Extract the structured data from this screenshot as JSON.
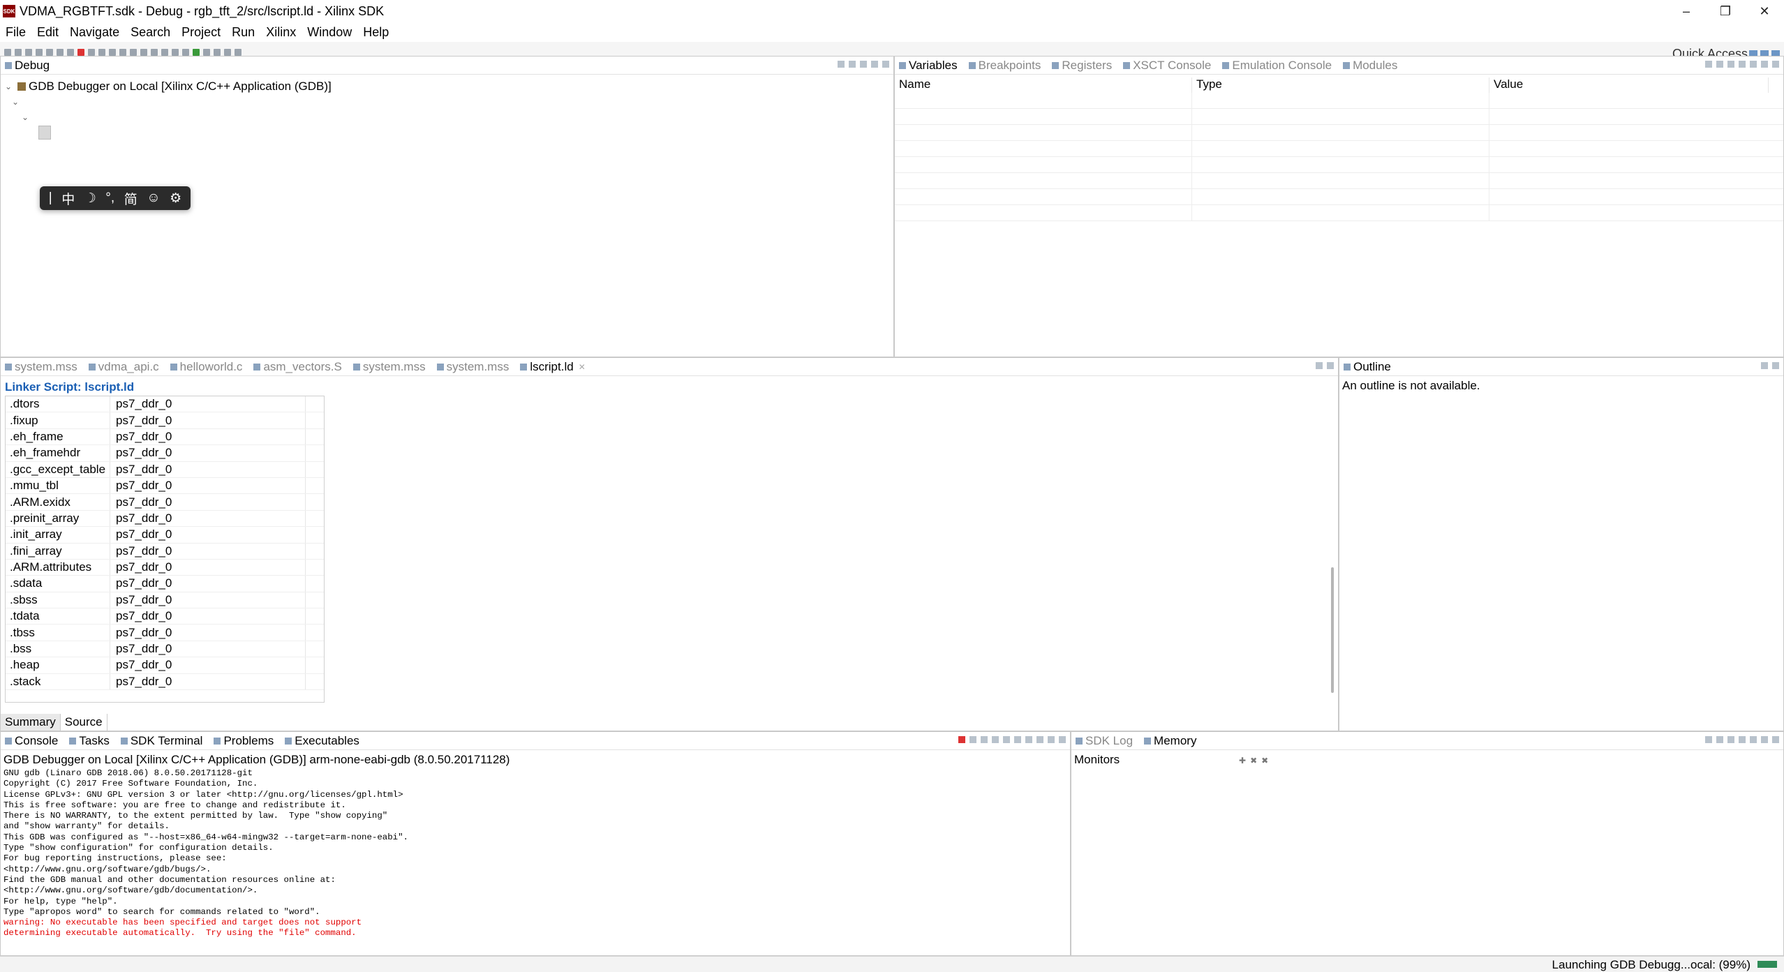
{
  "window": {
    "title": "VDMA_RGBTFT.sdk - Debug - rgb_tft_2/src/lscript.ld - Xilinx SDK",
    "app_icon": "SDK",
    "controls": [
      "–",
      "❐",
      "✕"
    ]
  },
  "menu": [
    "File",
    "Edit",
    "Navigate",
    "Search",
    "Project",
    "Run",
    "Xilinx",
    "Window",
    "Help"
  ],
  "toolbar": {
    "quick_access": "Quick Access"
  },
  "debug_view": {
    "tab": "Debug",
    "tree_root": "GDB Debugger on Local [Xilinx C/C++ Application (GDB)]"
  },
  "ime_bar": [
    "|",
    "中",
    "☽",
    "°,",
    "简",
    "☺",
    "⚙"
  ],
  "variables_view": {
    "tabs": [
      "Variables",
      "Breakpoints",
      "Registers",
      "XSCT Console",
      "Emulation Console",
      "Modules"
    ],
    "columns": [
      "Name",
      "Type",
      "Value"
    ]
  },
  "editor": {
    "tabs": [
      "system.mss",
      "vdma_api.c",
      "helloworld.c",
      "asm_vectors.S",
      "system.mss",
      "system.mss",
      "lscript.ld"
    ],
    "title": "Linker Script: lscript.ld",
    "sections": [
      {
        "name": ".dtors",
        "region": "ps7_ddr_0"
      },
      {
        "name": ".fixup",
        "region": "ps7_ddr_0"
      },
      {
        "name": ".eh_frame",
        "region": "ps7_ddr_0"
      },
      {
        "name": ".eh_framehdr",
        "region": "ps7_ddr_0"
      },
      {
        "name": ".gcc_except_table",
        "region": "ps7_ddr_0"
      },
      {
        "name": ".mmu_tbl",
        "region": "ps7_ddr_0"
      },
      {
        "name": ".ARM.exidx",
        "region": "ps7_ddr_0"
      },
      {
        "name": ".preinit_array",
        "region": "ps7_ddr_0"
      },
      {
        "name": ".init_array",
        "region": "ps7_ddr_0"
      },
      {
        "name": ".fini_array",
        "region": "ps7_ddr_0"
      },
      {
        "name": ".ARM.attributes",
        "region": "ps7_ddr_0"
      },
      {
        "name": ".sdata",
        "region": "ps7_ddr_0"
      },
      {
        "name": ".sbss",
        "region": "ps7_ddr_0"
      },
      {
        "name": ".tdata",
        "region": "ps7_ddr_0"
      },
      {
        "name": ".tbss",
        "region": "ps7_ddr_0"
      },
      {
        "name": ".bss",
        "region": "ps7_ddr_0"
      },
      {
        "name": ".heap",
        "region": "ps7_ddr_0"
      },
      {
        "name": ".stack",
        "region": "ps7_ddr_0"
      }
    ],
    "bottom_tabs": [
      "Summary",
      "Source"
    ]
  },
  "outline_view": {
    "tab": "Outline",
    "message": "An outline is not available."
  },
  "console_view": {
    "tabs": [
      "Console",
      "Tasks",
      "SDK Terminal",
      "Problems",
      "Executables"
    ],
    "description": "GDB Debugger on Local [Xilinx C/C++ Application (GDB)] arm-none-eabi-gdb (8.0.50.20171128)",
    "lines": [
      "GNU gdb (Linaro GDB 2018.06) 8.0.50.20171128-git",
      "Copyright (C) 2017 Free Software Foundation, Inc.",
      "License GPLv3+: GNU GPL version 3 or later <http://gnu.org/licenses/gpl.html>",
      "This is free software: you are free to change and redistribute it.",
      "There is NO WARRANTY, to the extent permitted by law.  Type \"show copying\"",
      "and \"show warranty\" for details.",
      "This GDB was configured as \"--host=x86_64-w64-mingw32 --target=arm-none-eabi\".",
      "Type \"show configuration\" for configuration details.",
      "For bug reporting instructions, please see:",
      "<http://www.gnu.org/software/gdb/bugs/>.",
      "Find the GDB manual and other documentation resources online at:",
      "<http://www.gnu.org/software/gdb/documentation/>.",
      "For help, type \"help\".",
      "Type \"apropos word\" to search for commands related to \"word\"."
    ],
    "error_lines": [
      "warning: No executable has been specified and target does not support",
      "determining executable automatically.  Try using the \"file\" command."
    ],
    "error_color": "#e00000"
  },
  "memory_view": {
    "tabs": [
      "SDK Log",
      "Memory"
    ],
    "monitors_label": "Monitors",
    "monitor_controls": [
      "✚",
      "✖",
      "✖"
    ]
  },
  "status": {
    "text": "Launching GDB Debugg...ocal: (99%)",
    "progress": 0.99
  }
}
